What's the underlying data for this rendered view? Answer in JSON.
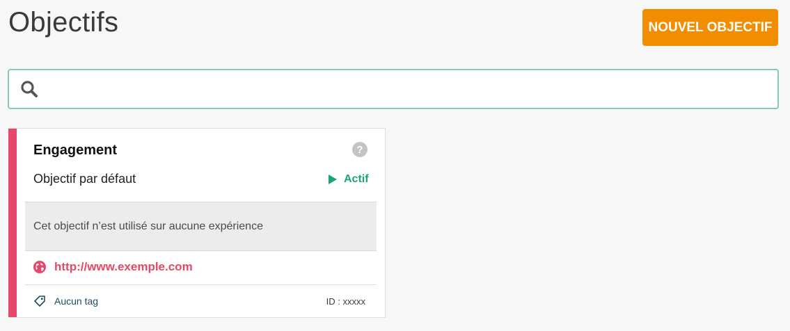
{
  "header": {
    "title": "Objectifs",
    "new_button_label": "NOUVEL OBJECTIF"
  },
  "search": {
    "value": "",
    "placeholder": ""
  },
  "goal_card": {
    "title": "Engagement",
    "subtitle": "Objectif par défaut",
    "status": "Actif",
    "usage_text": "Cet objectif n’est utilisé sur aucune expérience",
    "url": "http://www.exemple.com",
    "tags_label": "Aucun tag",
    "id_text": "ID : xxxxx"
  },
  "colors": {
    "primary_button": "#f28c00",
    "search_border": "#7fcdb5",
    "card_accent": "#e4486b",
    "status_active": "#1aa37f",
    "url": "#e4486b",
    "tag_text": "#1d4a66"
  },
  "icons": {
    "search": "search-icon",
    "help": "help-icon",
    "status": "play-icon",
    "url": "globe-icon",
    "tags": "tag-icon"
  }
}
